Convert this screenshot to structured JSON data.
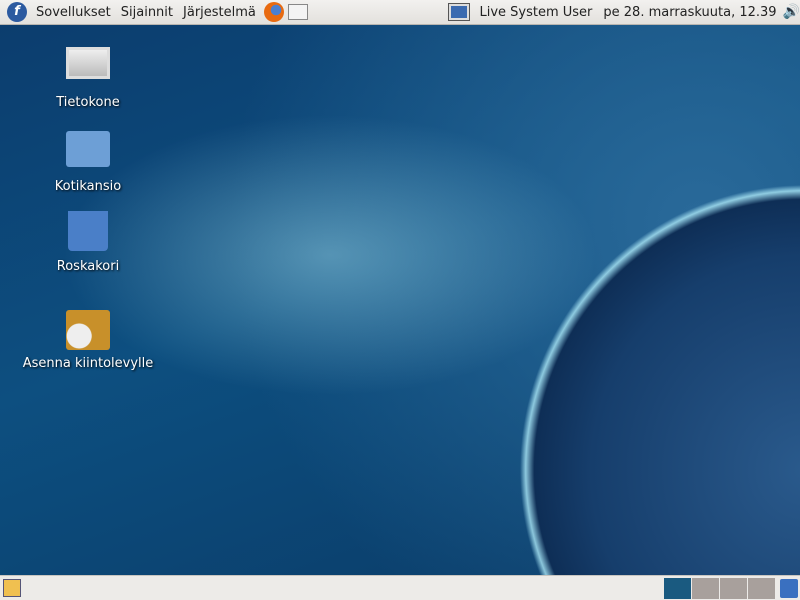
{
  "top_panel": {
    "menus": [
      "Sovellukset",
      "Sijainnit",
      "Järjestelmä"
    ],
    "user": "Live System User",
    "clock": "pe 28. marraskuuta, 12.39"
  },
  "desktop": {
    "icons": [
      "Tietokone",
      "Kotikansio",
      "Roskakori",
      "Asenna kiintolevylle"
    ]
  },
  "bottom_panel": {
    "workspaces": 4,
    "active_workspace": 1
  }
}
